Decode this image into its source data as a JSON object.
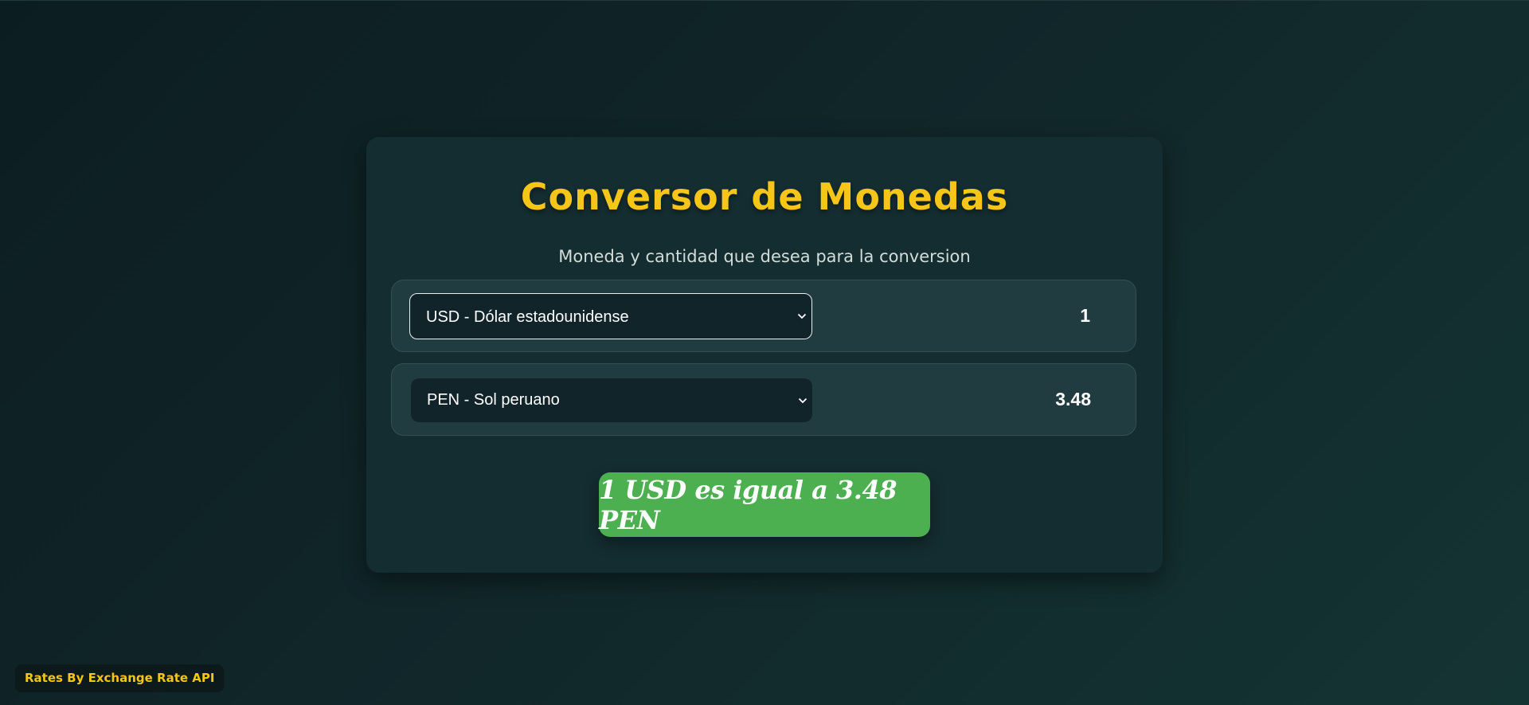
{
  "converter": {
    "title": "Conversor de Monedas",
    "subtitle": "Moneda y cantidad que desea para la conversion",
    "from": {
      "currency": "USD - Dólar estadounidense",
      "amount": "1"
    },
    "to": {
      "currency": "PEN - Sol peruano",
      "amount": "3.48"
    },
    "result": "1 USD es igual a 3.48 PEN"
  },
  "footer": {
    "credit": "Rates By Exchange Rate API"
  },
  "icons": {
    "dropdown": "chevron-down-icon"
  },
  "colors": {
    "title": "#f5c518",
    "result_background": "#4caf50",
    "card_background": "#142d31",
    "row_background": "#213c40"
  }
}
